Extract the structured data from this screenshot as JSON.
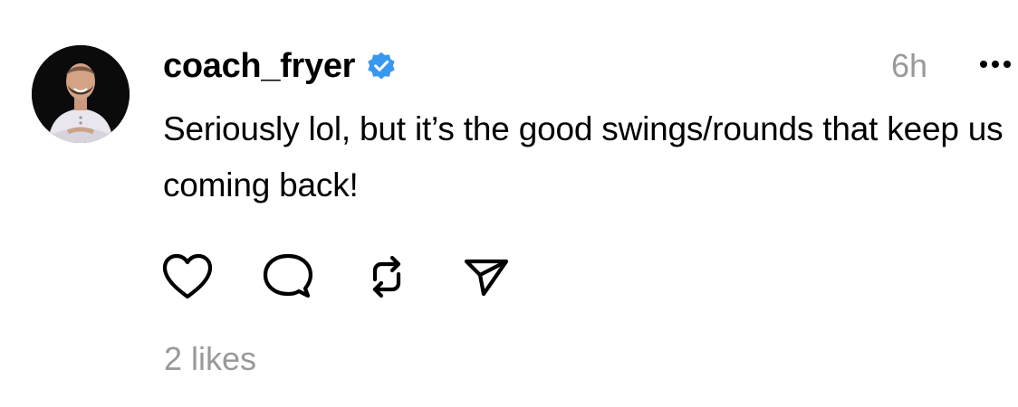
{
  "post": {
    "author": {
      "username": "coach_fryer",
      "verified": true,
      "verified_color": "#3897f0"
    },
    "timestamp": "6h",
    "text": "Seriously lol, but it’s the good swings/rounds that keep us coming back!",
    "actions": {
      "like_icon": "heart-icon",
      "reply_icon": "speech-bubble-icon",
      "repost_icon": "repost-icon",
      "share_icon": "send-icon"
    },
    "likes_label": "2 likes"
  },
  "colors": {
    "text": "#000000",
    "muted": "#999999",
    "background": "#ffffff"
  }
}
